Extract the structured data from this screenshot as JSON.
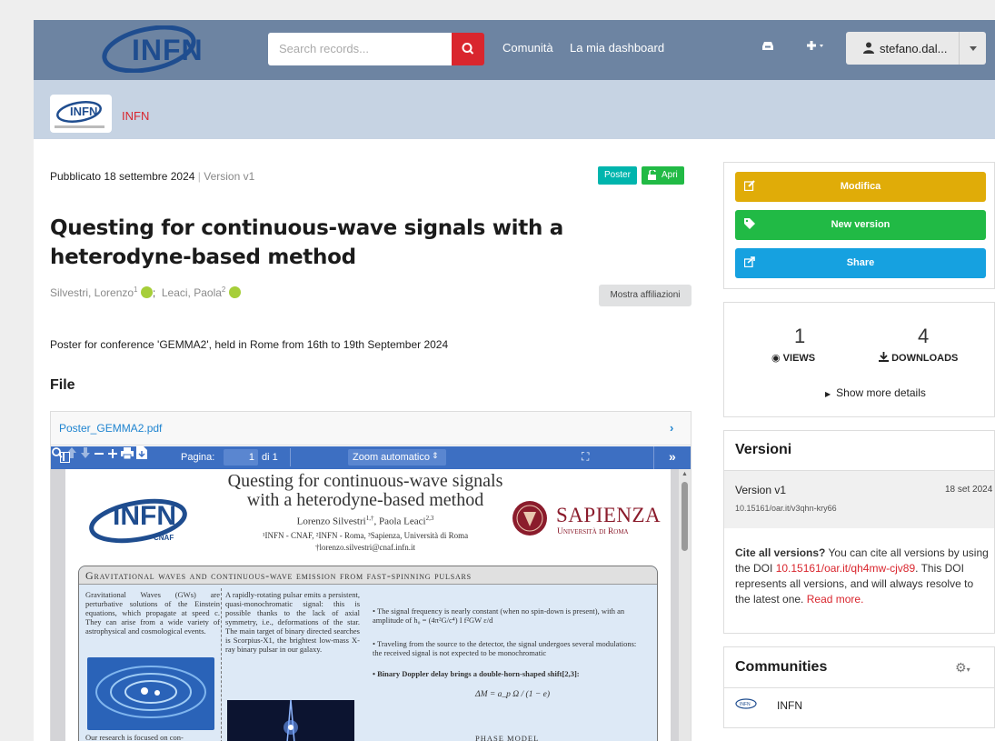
{
  "header": {
    "logo_text": "INFN",
    "search_placeholder": "Search records...",
    "nav": [
      "Comunità",
      "La mia dashboard"
    ],
    "user": "stefano.dal..."
  },
  "community_bar": {
    "name": "INFN",
    "logo_text": "INFN"
  },
  "record": {
    "published": "Pubblicato 18 settembre 2024",
    "version": "Version v1",
    "badge_type": "Poster",
    "badge_access": "Apri",
    "title": "Questing for continuous-wave signals with a heterodyne-based method",
    "author1": "Silvestri, Lorenzo",
    "author1_sup": "1",
    "author2": "Leaci, Paola",
    "author2_sup": "2",
    "affiliations_button": "Mostra affiliazioni",
    "description": "Poster for conference 'GEMMA2', held in Rome from 16th to 19th September 2024",
    "files_heading": "File"
  },
  "file_preview": {
    "filename": "Poster_GEMMA2.pdf",
    "toolbar": {
      "page_label": "Pagina:",
      "page_value": "1",
      "page_of": "di 1",
      "zoom_label": "Zoom automatico"
    },
    "poster": {
      "title_line1": "Questing for continuous-wave signals",
      "title_line2": "with a heterodyne-based method",
      "authors": "Lorenzo Silvestri",
      "authors_sup": "1,†",
      "authors_and": ", Paola Leaci",
      "authors2_sup": "2,3",
      "affil": "¹INFN - CNAF, ²INFN - Roma, ³Sapienza, Università di Roma",
      "email": "†lorenzo.silvestri@cnaf.infn.it",
      "infn_logo": "INFN",
      "infn_sub": "CNAF",
      "sapienza": "SAPIENZA",
      "sapienza_sub": "Università di Roma",
      "section_title": "Gravitational waves and continuous-wave emission from fast-spinning pulsars",
      "col1": "Gravitational Waves (GWs) are perturbative solutions of the Einstein equations, which propagate at speed c. They can arise from a wide variety of astrophysical and cosmological events.",
      "col1_bottom": "Our research is focused on con-",
      "col2": "A rapidly-rotating pulsar emits a persistent, quasi-monochromatic signal: this is possible thanks to the lack of axial symmetry, i.e., deformations of the star. The main target of binary directed searches is Scorpius-X1, the brightest low-mass X-ray binary pulsar in our galaxy.",
      "bullet1": "• The signal frequency is nearly constant (when no spin-down is present), with an amplitude of h₀ = (4π²G/c⁴) I f²GW ε/d",
      "bullet2": "• Traveling from the source to the detector, the signal undergoes several modulations: the received signal is not expected to be monochromatic",
      "bullet3": "• Binary Doppler delay brings a double-horn-shaped shift[2,3]:",
      "formula": "ΔM = a_p Ω / (1 − e)",
      "phase_model": "PHASE MODEL"
    }
  },
  "sidebar": {
    "actions": {
      "edit": "Modifica",
      "new_version": "New version",
      "share": "Share"
    },
    "stats": {
      "views": "1",
      "views_label": "VIEWS",
      "downloads": "4",
      "downloads_label": "DOWNLOADS",
      "more": "Show more details"
    },
    "versions": {
      "heading": "Versioni",
      "version": "Version v1",
      "date": "18 set 2024",
      "doi": "10.15161/oar.it/v3qhn-kry66",
      "cite_bold": "Cite all versions?",
      "cite_text1": " You can cite all versions by using the DOI ",
      "cite_doi": "10.15161/oar.it/qh4mw-cjv89",
      "cite_text2": ". This DOI represents all versions, and will always resolve to the latest one. ",
      "read_more": "Read more."
    },
    "communities": {
      "heading": "Communities",
      "item": "INFN"
    }
  },
  "colors": {
    "header": "#6d84a2",
    "subbar": "#c6d3e3",
    "brand_red": "#d9262e",
    "edit": "#e0ac08",
    "new_version": "#21ba45",
    "share": "#16a1e0",
    "link": "#2185d0"
  }
}
